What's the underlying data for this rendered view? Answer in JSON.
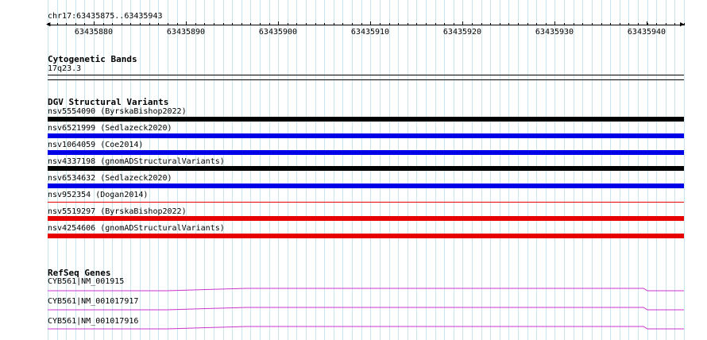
{
  "region": {
    "label": "chr17:63435875..63435943",
    "ticks": [
      "63435880",
      "63435890",
      "63435900",
      "63435910",
      "63435920",
      "63435930",
      "63435940"
    ]
  },
  "cytoband": {
    "title": "Cytogenetic Bands",
    "band": "17q23.3"
  },
  "dgv": {
    "title": "DGV Structural Variants",
    "features": [
      {
        "label": "nsv5554090 (ByrskaBishop2022)",
        "color": "#000000",
        "thick": true
      },
      {
        "label": "nsv6521999 (Sedlazeck2020)",
        "color": "#0000e6",
        "thick": true
      },
      {
        "label": "nsv1064059 (Coe2014)",
        "color": "#0000e6",
        "thick": true
      },
      {
        "label": "nsv4337198 (gnomADStructuralVariants)",
        "color": "#000000",
        "thick": true
      },
      {
        "label": "nsv6534632 (Sedlazeck2020)",
        "color": "#0000e6",
        "thick": true
      },
      {
        "label": "nsv952354 (Dogan2014)",
        "color": "#e60000",
        "thick": false
      },
      {
        "label": "nsv5519297 (ByrskaBishop2022)",
        "color": "#e60000",
        "thick": true
      },
      {
        "label": "nsv4254606 (gnomADStructuralVariants)",
        "color": "#e60000",
        "thick": true
      }
    ]
  },
  "refseq": {
    "title": "RefSeq Genes",
    "genes": [
      {
        "label": "CYB561|NM_001915",
        "color": "#cc33cc"
      },
      {
        "label": "CYB561|NM_001017917",
        "color": "#cc33cc"
      },
      {
        "label": "CYB561|NM_001017916",
        "color": "#cc33cc"
      }
    ]
  },
  "colors": {
    "grid": "#c9e6ee",
    "gene": "#cc33cc"
  }
}
